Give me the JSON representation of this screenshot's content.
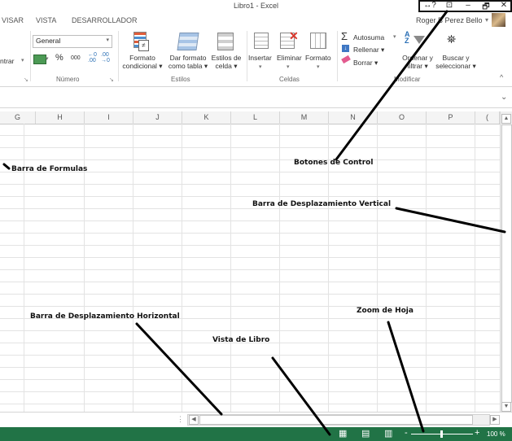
{
  "window": {
    "title": "Libro1 - Excel",
    "help_icon": "↔?",
    "restore_ribbon_icon": "⊡",
    "minimize_icon": "–",
    "maximize_icon": "🗗",
    "close_icon": "✕"
  },
  "tabs": [
    "VISAR",
    "VISTA",
    "DESARROLLADOR"
  ],
  "user": {
    "name": "Roger B Perez Bello",
    "dropdown": "▾"
  },
  "ribbon": {
    "left_partial": "ntrar",
    "number": {
      "format_value": "General",
      "percent": "%",
      "thousands": "000",
      "inc_decimal": "⁺⁰⁰₀",
      "dec_decimal": "⁰₀₀",
      "label": "Número"
    },
    "styles": {
      "conditional_l1": "Formato",
      "conditional_l2": "condicional ▾",
      "table_l1": "Dar formato",
      "table_l2": "como tabla ▾",
      "cell_l1": "Estilos de",
      "cell_l2": "celda ▾",
      "label": "Estilos"
    },
    "cells": {
      "insert": "Insertar",
      "delete": "Eliminar",
      "format": "Formato",
      "label": "Celdas"
    },
    "editing": {
      "autosum": "Autosuma",
      "fill": "Rellenar ▾",
      "clear": "Borrar ▾",
      "sort_l1": "Ordenar y",
      "sort_l2": "filtrar ▾",
      "find_l1": "Buscar y",
      "find_l2": "seleccionar ▾",
      "label": "Modificar"
    },
    "collapse": "^"
  },
  "formula_bar": {
    "expand": "⌄"
  },
  "columns": [
    "G",
    "H",
    "I",
    "J",
    "K",
    "L",
    "M",
    "N",
    "O",
    "P",
    "("
  ],
  "scroll": {
    "up": "▲",
    "down": "▼",
    "left": "◀",
    "right": "▶",
    "split": "⋮"
  },
  "status": {
    "normal_view_icon": "▦",
    "page_layout_icon": "▤",
    "page_break_icon": "▥",
    "zoom_minus": "-",
    "zoom_plus": "+",
    "zoom_value": "100 %"
  },
  "annotations": {
    "formulas": "Barra de Formulas",
    "control": "Botones de Control",
    "vscroll": "Barra de Desplazamiento Vertical",
    "hscroll": "Barra de Desplazamiento Horizontal",
    "book_view": "Vista de Libro",
    "zoom": "Zoom de Hoja"
  }
}
